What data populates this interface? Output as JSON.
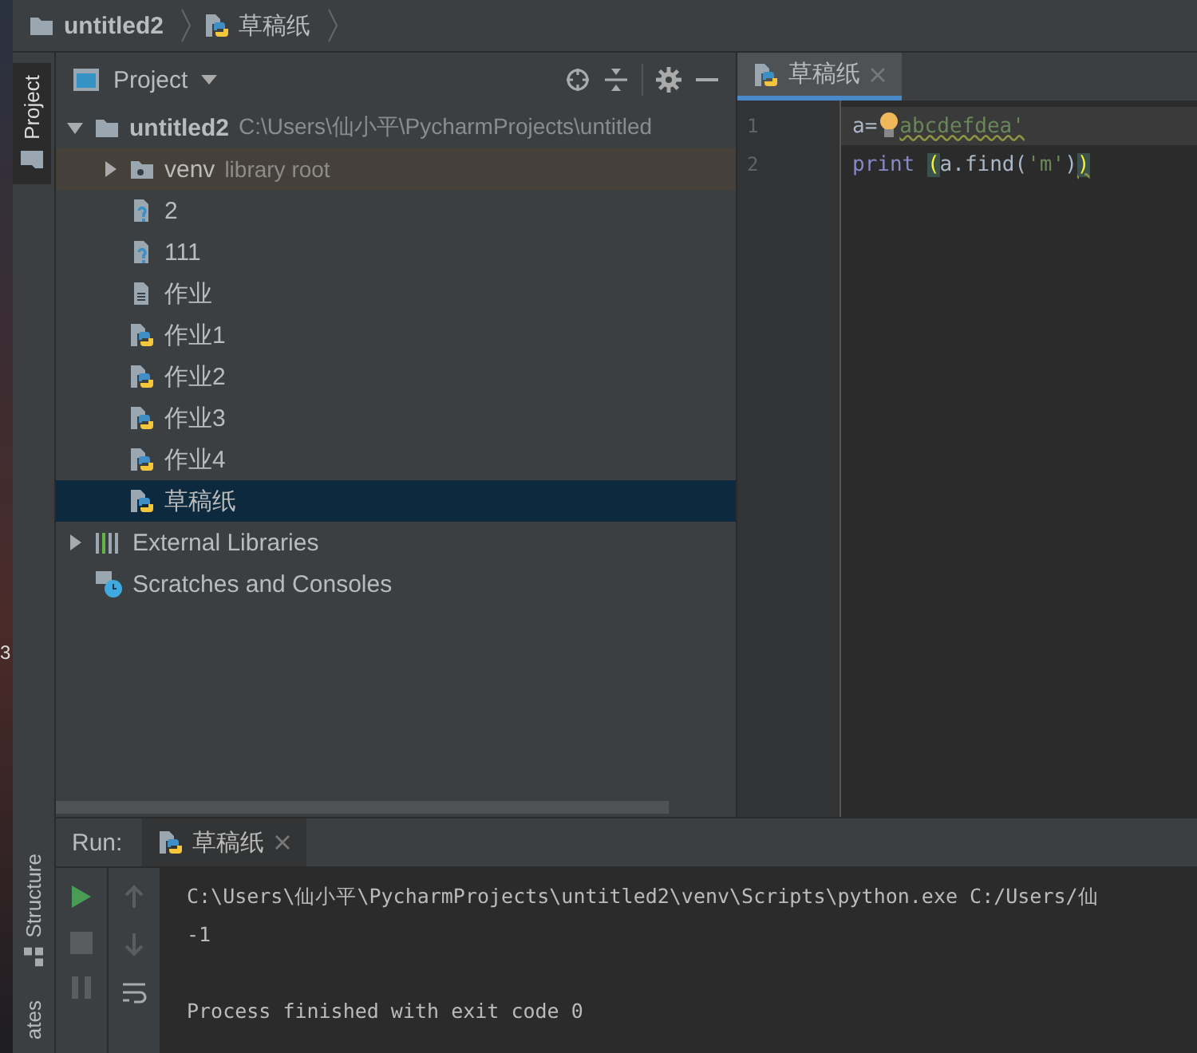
{
  "desktop_edge": {
    "text": "3"
  },
  "breadcrumb": [
    {
      "label": "untitled2",
      "kind": "folder"
    },
    {
      "label": "草稿纸",
      "kind": "python"
    }
  ],
  "left_stripe": {
    "top": [
      {
        "label": "Project",
        "selected": true
      }
    ],
    "bottom": [
      {
        "label": "Structure",
        "selected": false
      },
      {
        "label": "ates",
        "selected": false
      }
    ]
  },
  "project_panel": {
    "title": "Project",
    "tree": [
      {
        "label": "untitled2",
        "hint": "C:\\Users\\仙小平\\PycharmProjects\\untitled",
        "kind": "folder",
        "expanded": true,
        "selected": false,
        "children": [
          {
            "label": "venv",
            "hint": "library root",
            "kind": "venv",
            "expanded": false,
            "selected": false
          },
          {
            "label": "2",
            "kind": "unknown",
            "selected": false
          },
          {
            "label": "111",
            "kind": "unknown",
            "selected": false
          },
          {
            "label": "作业",
            "kind": "text",
            "selected": false
          },
          {
            "label": "作业1",
            "kind": "python",
            "selected": false
          },
          {
            "label": "作业2",
            "kind": "python",
            "selected": false
          },
          {
            "label": "作业3",
            "kind": "python",
            "selected": false
          },
          {
            "label": "作业4",
            "kind": "python",
            "selected": false
          },
          {
            "label": "草稿纸",
            "kind": "python",
            "selected": true
          }
        ]
      },
      {
        "label": "External Libraries",
        "kind": "libraries",
        "expanded": false,
        "selected": false
      },
      {
        "label": "Scratches and Consoles",
        "kind": "scratches",
        "selected": false
      }
    ]
  },
  "editor": {
    "tabs": [
      {
        "label": "草稿纸",
        "selected": true
      }
    ],
    "lines": [
      {
        "number": "1",
        "current": true,
        "tokens": [
          {
            "text": "a=",
            "kind": "plain"
          },
          {
            "kind": "bulb"
          },
          {
            "text": "abcdefdea'",
            "kind": "string",
            "warning": true
          }
        ]
      },
      {
        "number": "2",
        "current": false,
        "tokens": [
          {
            "text": "print ",
            "kind": "keyword"
          },
          {
            "text": "(",
            "kind": "paren_match"
          },
          {
            "text": "a.find(",
            "kind": "plain"
          },
          {
            "text": "'m'",
            "kind": "string"
          },
          {
            "text": ")",
            "kind": "plain"
          },
          {
            "text": ")",
            "kind": "paren_match",
            "warning": true
          }
        ]
      }
    ]
  },
  "run_panel": {
    "title": "Run:",
    "tabs": [
      {
        "label": "草稿纸",
        "selected": true
      }
    ],
    "output": [
      {
        "text": "C:\\Users\\仙小平\\PycharmProjects\\untitled2\\venv\\Scripts\\python.exe C:/Users/仙",
        "kind": "command"
      },
      {
        "text": "-1",
        "kind": "stdout"
      },
      {
        "text": "Process finished with exit code 0",
        "kind": "exit"
      }
    ]
  }
}
